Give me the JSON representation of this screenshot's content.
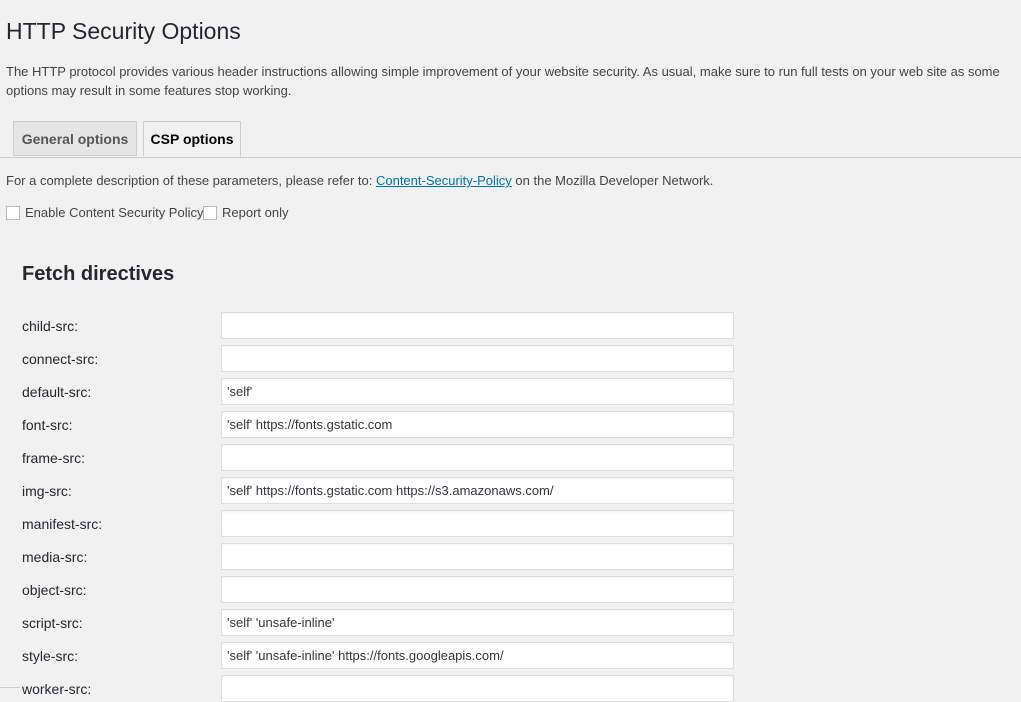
{
  "page_title": "HTTP Security Options",
  "intro": "The HTTP protocol provides various header instructions allowing simple improvement of your website security. As usual, make sure to run full tests on your web site as some options may result in some features stop working.",
  "tabs": [
    {
      "label": "General options",
      "active": false
    },
    {
      "label": "CSP options",
      "active": true
    }
  ],
  "description": {
    "before": "For a complete description of these parameters, please refer to: ",
    "link": "Content-Security-Policy",
    "after": " on the Mozilla Developer Network."
  },
  "checkboxes": {
    "enable_csp": {
      "label": "Enable Content Security Policy",
      "checked": false
    },
    "report_only": {
      "label": "Report only",
      "checked": false
    }
  },
  "section_title": "Fetch directives",
  "directives": [
    {
      "label": "child-src:",
      "value": ""
    },
    {
      "label": "connect-src:",
      "value": ""
    },
    {
      "label": "default-src:",
      "value": "'self'"
    },
    {
      "label": "font-src:",
      "value": "'self' https://fonts.gstatic.com"
    },
    {
      "label": "frame-src:",
      "value": ""
    },
    {
      "label": "img-src:",
      "value": "'self' https://fonts.gstatic.com https://s3.amazonaws.com/"
    },
    {
      "label": "manifest-src:",
      "value": ""
    },
    {
      "label": "media-src:",
      "value": ""
    },
    {
      "label": "object-src:",
      "value": ""
    },
    {
      "label": "script-src:",
      "value": "'self' 'unsafe-inline'"
    },
    {
      "label": "style-src:",
      "value": "'self' 'unsafe-inline' https://fonts.googleapis.com/"
    },
    {
      "label": "worker-src:",
      "value": ""
    }
  ]
}
